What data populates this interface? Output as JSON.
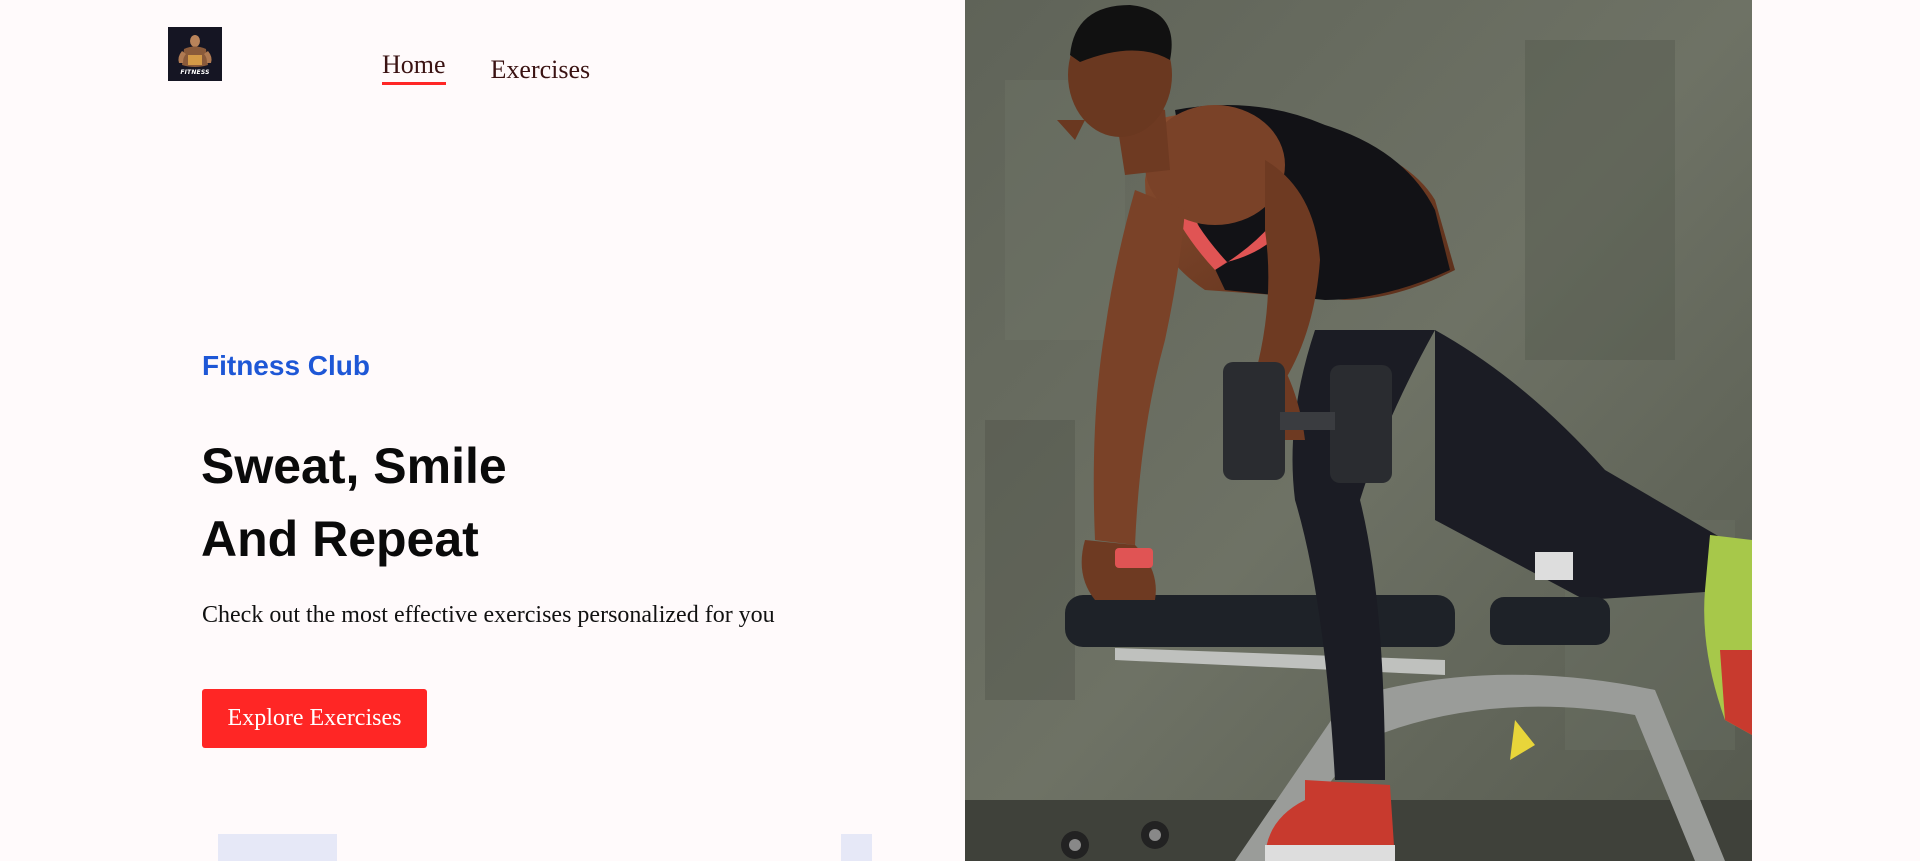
{
  "header": {
    "logo_text": "FITNESS",
    "nav": [
      {
        "label": "Home",
        "active": true
      },
      {
        "label": "Exercises",
        "active": false
      }
    ]
  },
  "hero": {
    "eyebrow": "Fitness Club",
    "title_line1": "Sweat, Smile",
    "title_line2": "And Repeat",
    "subtitle": "Check out the most effective exercises personalized for you",
    "cta_label": "Explore Exercises"
  },
  "colors": {
    "accent": "#FF2625",
    "eyebrow": "#1E57D6",
    "background": "#FFFAFB",
    "nav_text": "#3A1212"
  }
}
